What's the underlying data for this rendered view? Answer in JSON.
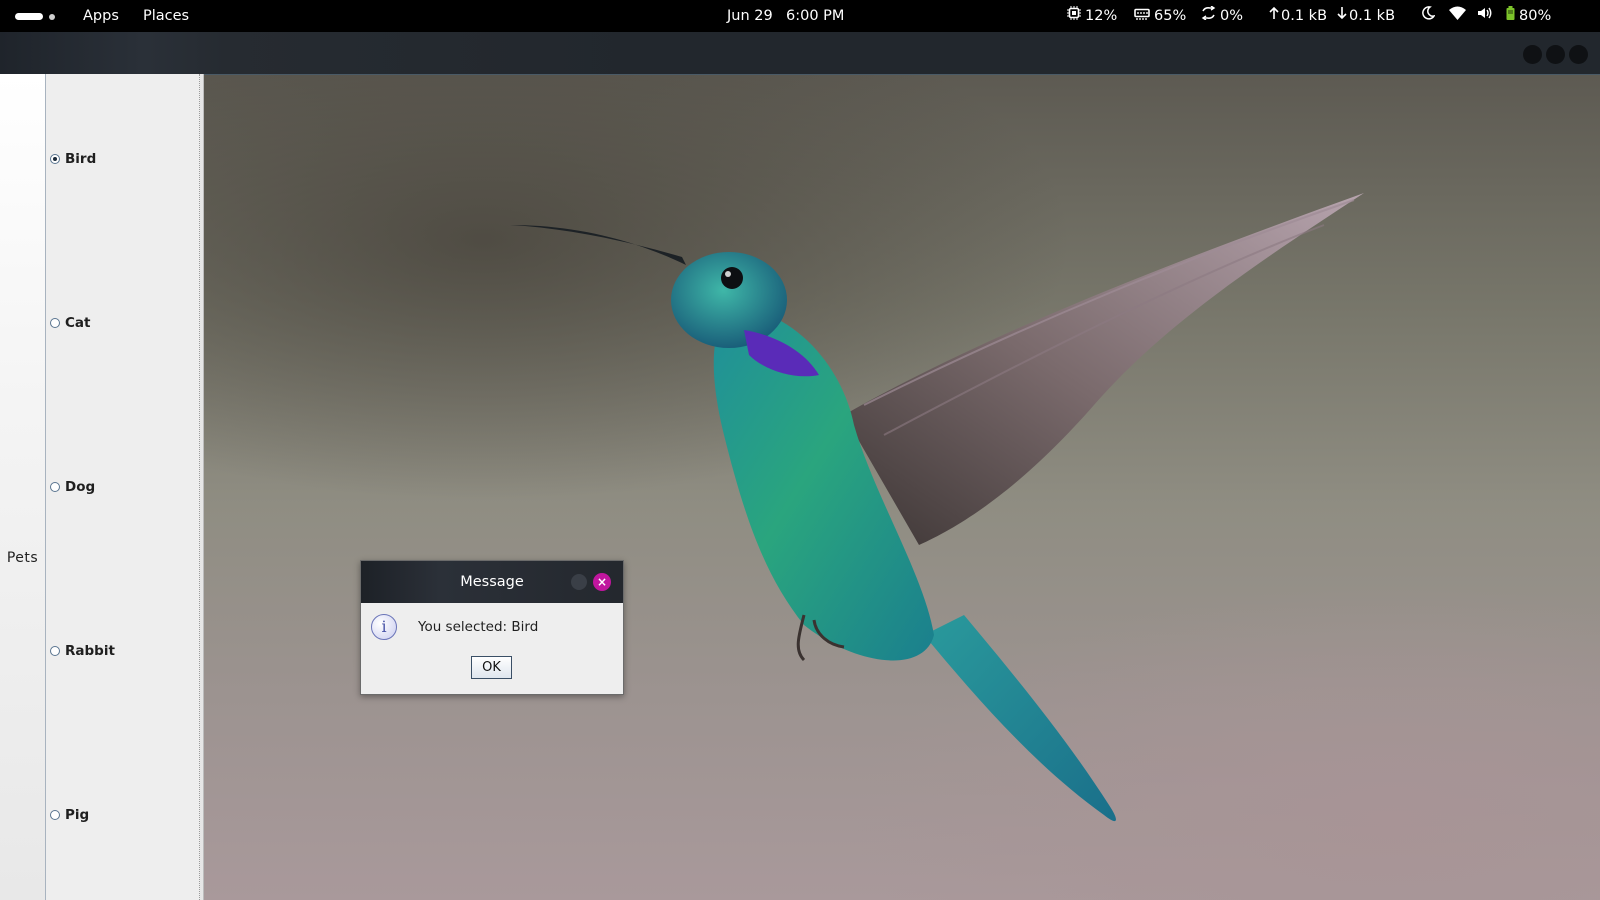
{
  "topbar": {
    "apps_label": "Apps",
    "places_label": "Places",
    "date": "Jun 29",
    "time": "6:00 PM",
    "cpu": "12%",
    "memory": "65%",
    "swap": "0%",
    "upload": "0.1 kB",
    "download": "0.1 kB",
    "battery": "80%"
  },
  "sidebar": {
    "tab_label": "Pets",
    "options": [
      {
        "label": "Bird",
        "checked": true
      },
      {
        "label": "Cat",
        "checked": false
      },
      {
        "label": "Dog",
        "checked": false
      },
      {
        "label": "Rabbit",
        "checked": false
      },
      {
        "label": "Pig",
        "checked": false
      }
    ]
  },
  "dialog": {
    "title": "Message",
    "message": "You selected: Bird",
    "ok_label": "OK",
    "info_glyph": "i",
    "close_glyph": "×"
  },
  "colors": {
    "topbar_bg": "#000000",
    "close_accent": "#c0169e",
    "battery_green": "#7cc32a"
  },
  "icons": [
    "cpu-icon",
    "memory-icon",
    "swap-icon",
    "upload-arrow-icon",
    "download-arrow-icon",
    "night-mode-icon",
    "wifi-icon",
    "volume-icon",
    "battery-icon",
    "info-icon",
    "close-icon"
  ]
}
